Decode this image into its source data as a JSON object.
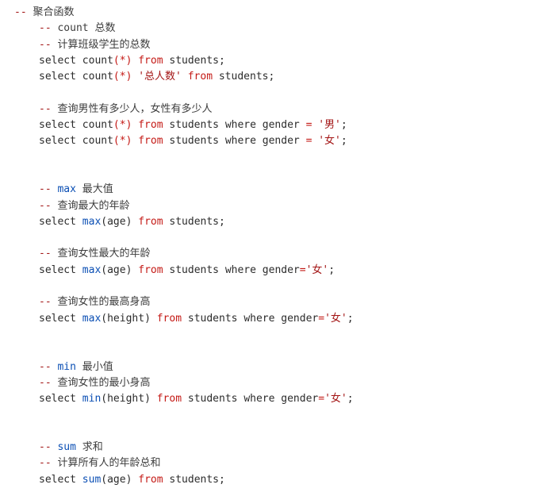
{
  "lines": [
    {
      "indent": 0,
      "parts": [
        {
          "t": "-- ",
          "c": "dash"
        },
        {
          "t": "聚合函数",
          "c": "comment"
        }
      ]
    },
    {
      "indent": 1,
      "parts": [
        {
          "t": "-- ",
          "c": "dash"
        },
        {
          "t": "count 总数",
          "c": "comment"
        }
      ]
    },
    {
      "indent": 1,
      "parts": [
        {
          "t": "-- ",
          "c": "dash"
        },
        {
          "t": "计算班级学生的总数",
          "c": "comment"
        }
      ]
    },
    {
      "indent": 1,
      "parts": [
        {
          "t": "select count",
          "c": "plain"
        },
        {
          "t": "(*)",
          "c": "paren-star"
        },
        {
          "t": " ",
          "c": "plain"
        },
        {
          "t": "from",
          "c": "kw-from"
        },
        {
          "t": " students;",
          "c": "plain"
        }
      ]
    },
    {
      "indent": 1,
      "parts": [
        {
          "t": "select count",
          "c": "plain"
        },
        {
          "t": "(*)",
          "c": "paren-star"
        },
        {
          "t": " ",
          "c": "plain"
        },
        {
          "t": "'总人数'",
          "c": "string"
        },
        {
          "t": " ",
          "c": "plain"
        },
        {
          "t": "from",
          "c": "kw-from"
        },
        {
          "t": " students;",
          "c": "plain"
        }
      ]
    },
    {
      "blank": true
    },
    {
      "indent": 1,
      "parts": [
        {
          "t": "-- ",
          "c": "dash"
        },
        {
          "t": "查询男性有多少人，女性有多少人",
          "c": "comment"
        }
      ]
    },
    {
      "indent": 1,
      "parts": [
        {
          "t": "select count",
          "c": "plain"
        },
        {
          "t": "(*)",
          "c": "paren-star"
        },
        {
          "t": " ",
          "c": "plain"
        },
        {
          "t": "from",
          "c": "kw-from"
        },
        {
          "t": " students where gender ",
          "c": "plain"
        },
        {
          "t": "=",
          "c": "op"
        },
        {
          "t": " ",
          "c": "plain"
        },
        {
          "t": "'男'",
          "c": "string"
        },
        {
          "t": ";",
          "c": "plain"
        }
      ]
    },
    {
      "indent": 1,
      "parts": [
        {
          "t": "select count",
          "c": "plain"
        },
        {
          "t": "(*)",
          "c": "paren-star"
        },
        {
          "t": " ",
          "c": "plain"
        },
        {
          "t": "from",
          "c": "kw-from"
        },
        {
          "t": " students where gender ",
          "c": "plain"
        },
        {
          "t": "=",
          "c": "op"
        },
        {
          "t": " ",
          "c": "plain"
        },
        {
          "t": "'女'",
          "c": "string"
        },
        {
          "t": ";",
          "c": "plain"
        }
      ]
    },
    {
      "blank": true
    },
    {
      "blank": true
    },
    {
      "indent": 1,
      "parts": [
        {
          "t": "-- ",
          "c": "dash"
        },
        {
          "t": "max",
          "c": "func"
        },
        {
          "t": " 最大值",
          "c": "comment"
        }
      ]
    },
    {
      "indent": 1,
      "parts": [
        {
          "t": "-- ",
          "c": "dash"
        },
        {
          "t": "查询最大的年龄",
          "c": "comment"
        }
      ]
    },
    {
      "indent": 1,
      "parts": [
        {
          "t": "select ",
          "c": "plain"
        },
        {
          "t": "max",
          "c": "func"
        },
        {
          "t": "(age) ",
          "c": "plain"
        },
        {
          "t": "from",
          "c": "kw-from"
        },
        {
          "t": " students;",
          "c": "plain"
        }
      ]
    },
    {
      "blank": true
    },
    {
      "indent": 1,
      "parts": [
        {
          "t": "-- ",
          "c": "dash"
        },
        {
          "t": "查询女性最大的年龄",
          "c": "comment"
        }
      ]
    },
    {
      "indent": 1,
      "parts": [
        {
          "t": "select ",
          "c": "plain"
        },
        {
          "t": "max",
          "c": "func"
        },
        {
          "t": "(age) ",
          "c": "plain"
        },
        {
          "t": "from",
          "c": "kw-from"
        },
        {
          "t": " students where gender",
          "c": "plain"
        },
        {
          "t": "=",
          "c": "op"
        },
        {
          "t": "'女'",
          "c": "string"
        },
        {
          "t": ";",
          "c": "plain"
        }
      ]
    },
    {
      "blank": true
    },
    {
      "indent": 1,
      "parts": [
        {
          "t": "-- ",
          "c": "dash"
        },
        {
          "t": "查询女性的最高身高",
          "c": "comment"
        }
      ]
    },
    {
      "indent": 1,
      "parts": [
        {
          "t": "select ",
          "c": "plain"
        },
        {
          "t": "max",
          "c": "func"
        },
        {
          "t": "(height) ",
          "c": "plain"
        },
        {
          "t": "from",
          "c": "kw-from"
        },
        {
          "t": " students where gender",
          "c": "plain"
        },
        {
          "t": "=",
          "c": "op"
        },
        {
          "t": "'女'",
          "c": "string"
        },
        {
          "t": ";",
          "c": "plain"
        }
      ]
    },
    {
      "blank": true
    },
    {
      "blank": true
    },
    {
      "indent": 1,
      "parts": [
        {
          "t": "-- ",
          "c": "dash"
        },
        {
          "t": "min",
          "c": "func"
        },
        {
          "t": " 最小值",
          "c": "comment"
        }
      ]
    },
    {
      "indent": 1,
      "parts": [
        {
          "t": "-- ",
          "c": "dash"
        },
        {
          "t": "查询女性的最小身高",
          "c": "comment"
        }
      ]
    },
    {
      "indent": 1,
      "parts": [
        {
          "t": "select ",
          "c": "plain"
        },
        {
          "t": "min",
          "c": "func"
        },
        {
          "t": "(height) ",
          "c": "plain"
        },
        {
          "t": "from",
          "c": "kw-from"
        },
        {
          "t": " students where gender",
          "c": "plain"
        },
        {
          "t": "=",
          "c": "op"
        },
        {
          "t": "'女'",
          "c": "string"
        },
        {
          "t": ";",
          "c": "plain"
        }
      ]
    },
    {
      "blank": true
    },
    {
      "blank": true
    },
    {
      "indent": 1,
      "parts": [
        {
          "t": "-- ",
          "c": "dash"
        },
        {
          "t": "sum",
          "c": "func"
        },
        {
          "t": " 求和",
          "c": "comment"
        }
      ]
    },
    {
      "indent": 1,
      "parts": [
        {
          "t": "-- ",
          "c": "dash"
        },
        {
          "t": "计算所有人的年龄总和",
          "c": "comment"
        }
      ]
    },
    {
      "indent": 1,
      "parts": [
        {
          "t": "select ",
          "c": "plain"
        },
        {
          "t": "sum",
          "c": "func"
        },
        {
          "t": "(age) ",
          "c": "plain"
        },
        {
          "t": "from",
          "c": "kw-from"
        },
        {
          "t": " students;",
          "c": "plain"
        }
      ]
    }
  ]
}
